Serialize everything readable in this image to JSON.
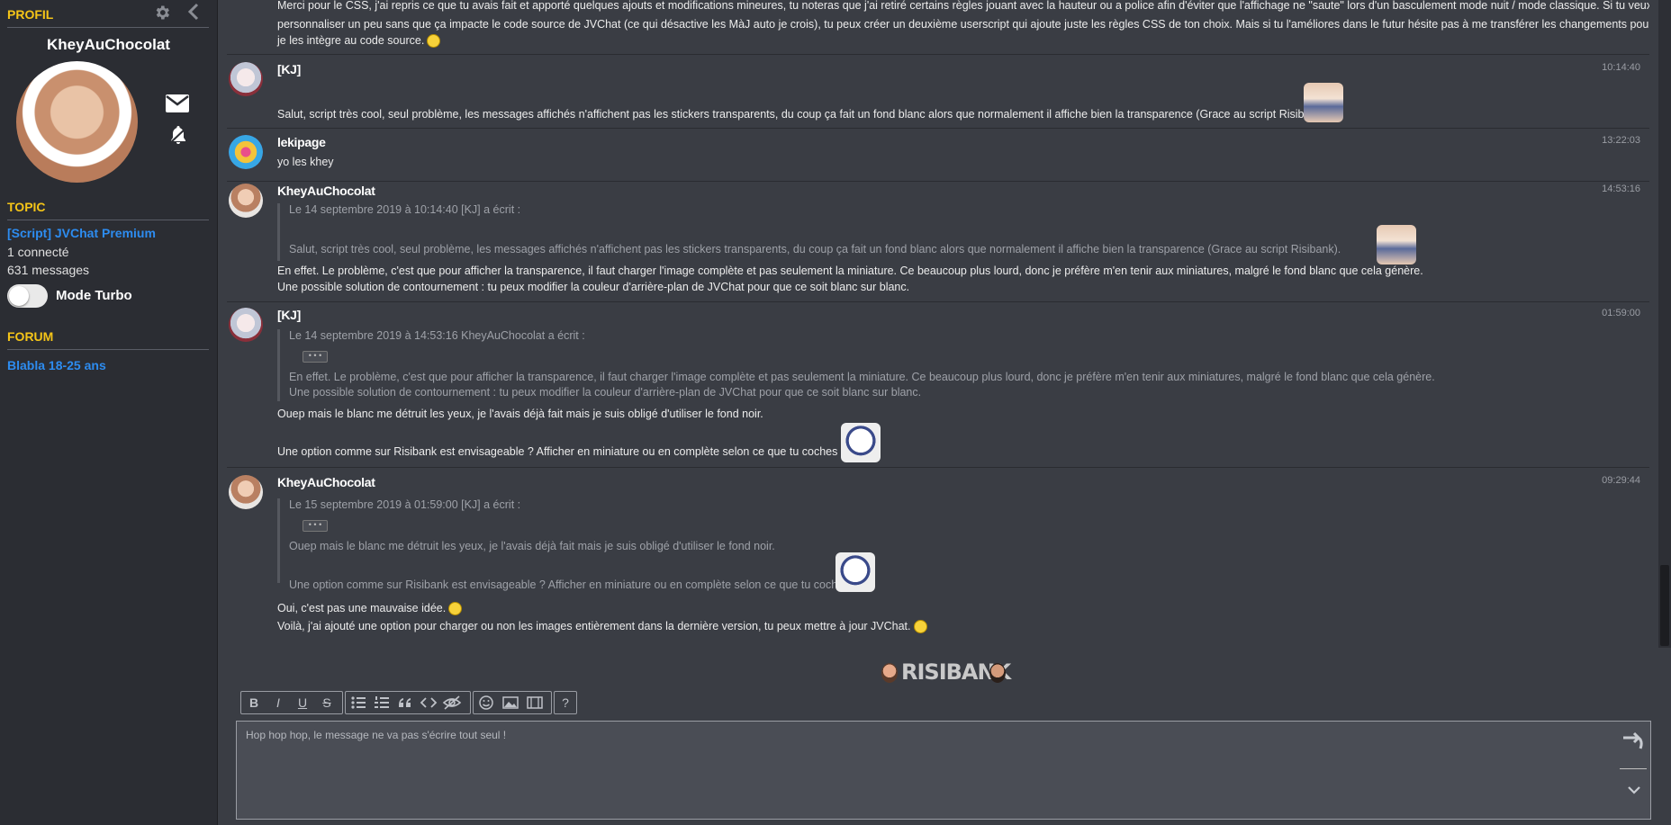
{
  "sidebar": {
    "profil_heading": "PROFIL",
    "username": "KheyAuChocolat",
    "topic_heading": "TOPIC",
    "topic_title": "[Script] JVChat Premium",
    "connected": "1 connecté",
    "messages_count": "631 messages",
    "turbo_label": "Mode Turbo",
    "forum_heading": "FORUM",
    "forum_name": "Blabla 18-25 ans"
  },
  "messages": [
    {
      "partial": true,
      "lines": [
        "Merci pour le CSS, j'ai repris ce que tu avais fait et apporté quelques ajouts et modifications mineures, tu noteras que j'ai retiré certains règles jouant avec la hauteur ou a police afin d'éviter que l'affichage ne \"saute\" lors d'un basculement mode nuit / mode classique. Si tu veux",
        "personnaliser un peu sans que ça impacte le code source de JVChat (ce qui désactive les MàJ auto je crois), tu peux créer un deuxième userscript qui ajoute juste les règles CSS de ton choix. Mais si tu l'améliores dans le futur hésite pas à me transférer les changements pour que",
        "je les intègre au code source."
      ]
    },
    {
      "author": "[KJ]",
      "time": "10:14:40",
      "text": "Salut, script très cool, seul problème, les messages affichés n'affichent pas les stickers transparents, du coup ça fait un fond blanc alors que normalement il affiche bien la transparence (Grace au script Risibank)."
    },
    {
      "author": "lekipage",
      "time": "13:22:03",
      "text": "yo les khey"
    },
    {
      "author": "KheyAuChocolat",
      "time": "14:53:16",
      "quote_header": "Le 14 septembre 2019 à 10:14:40 [KJ] a écrit :",
      "quote_text": "Salut, script très cool, seul problème, les messages affichés n'affichent pas les stickers transparents, du coup ça fait un fond blanc alors que normalement il affiche bien la transparence (Grace au script Risibank).",
      "lines": [
        "En effet. Le problème, c'est que pour afficher la transparence, il faut charger l'image complète et pas seulement la miniature. Ce beaucoup plus lourd, donc je préfère m'en tenir aux miniatures, malgré le fond blanc que cela génère.",
        "Une possible solution de contournement : tu peux modifier la couleur d'arrière-plan de JVChat pour que ce soit blanc sur blanc."
      ]
    },
    {
      "author": "[KJ]",
      "time": "01:59:00",
      "quote_header": "Le 14 septembre 2019 à 14:53:16 KheyAuChocolat a écrit :",
      "quote_collapsed": "• • •",
      "quote_lines": [
        "En effet. Le problème, c'est que pour afficher la transparence, il faut charger l'image complète et pas seulement la miniature. Ce beaucoup plus lourd, donc je préfère m'en tenir aux miniatures, malgré le fond blanc que cela génère.",
        "Une possible solution de contournement : tu peux modifier la couleur d'arrière-plan de JVChat pour que ce soit blanc sur blanc."
      ],
      "lines": [
        "Ouep mais le blanc me détruit les yeux, je l'avais déjà fait mais je suis obligé d'utiliser le fond noir.",
        "Une option comme sur Risibank est envisageable ? Afficher en miniature ou en complète selon ce que tu coches ?"
      ]
    },
    {
      "author": "KheyAuChocolat",
      "time": "09:29:44",
      "quote_header": "Le 15 septembre 2019 à 01:59:00 [KJ] a écrit :",
      "quote_collapsed": "• • •",
      "quote_lines": [
        "Ouep mais le blanc me détruit les yeux, je l'avais déjà fait mais je suis obligé d'utiliser le fond noir.",
        "Une option comme sur Risibank est envisageable ? Afficher en miniature ou en complète selon ce que tu coches ?"
      ],
      "lines": [
        "Oui, c'est pas une mauvaise idée.",
        "Voilà, j'ai ajouté une option pour charger ou non les images entièrement dans la dernière version, tu peux mettre à jour JVChat."
      ]
    }
  ],
  "editor": {
    "risibank_label": "RISIBANK",
    "placeholder": "Hop hop hop, le message ne va pas s'écrire tout seul !",
    "toolbar": {
      "bold": "B",
      "italic": "I",
      "underline": "U",
      "strike": "S",
      "help": "?"
    }
  },
  "colors": {
    "accent_yellow": "#f5c518",
    "link_blue": "#2d8cf0",
    "background": "#3a3d44",
    "sidebar": "#2b2d33"
  }
}
